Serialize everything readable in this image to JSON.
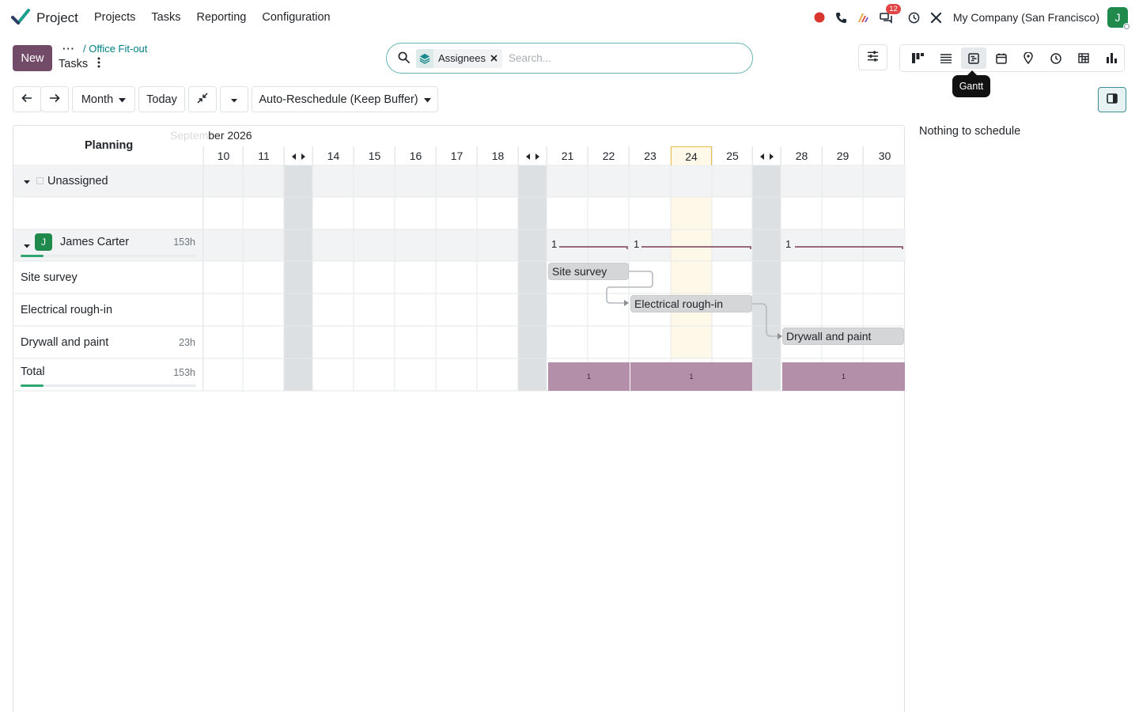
{
  "app": {
    "name": "Project"
  },
  "menu": [
    "Projects",
    "Tasks",
    "Reporting",
    "Configuration"
  ],
  "systray": {
    "messages_count": "12",
    "company": "My Company (San Francisco)",
    "avatar": "J"
  },
  "control": {
    "new_label": "New",
    "breadcrumb_parent": "/ Office Fit-out",
    "breadcrumb_current": "Tasks",
    "search": {
      "facet": "Assignees",
      "placeholder": "Search..."
    },
    "tooltip": "Gantt"
  },
  "toolbar": {
    "scale": "Month",
    "today": "Today",
    "reschedule": "Auto-Reschedule (Keep Buffer)"
  },
  "side_panel": {
    "text": "Nothing to schedule"
  },
  "gantt": {
    "title": "Planning",
    "month_visible": "ber 2026",
    "month_hidden": "Septem",
    "days": [
      "10",
      "11",
      "14",
      "15",
      "16",
      "17",
      "18",
      "21",
      "22",
      "23",
      "24",
      "25",
      "28",
      "29",
      "30"
    ],
    "today": "24",
    "rows": {
      "unassigned": "Unassigned",
      "assignee": {
        "name": "James Carter",
        "avatar": "J",
        "hours": "153h",
        "progress": 0.13
      },
      "tasks": [
        {
          "name": "Site survey",
          "hours": ""
        },
        {
          "name": "Electrical rough-in",
          "hours": ""
        },
        {
          "name": "Drywall and paint",
          "hours": "23h"
        }
      ],
      "total": {
        "label": "Total",
        "hours": "153h",
        "progress": 0.13
      }
    },
    "pills": [
      "Site survey",
      "Electrical rough-in",
      "Drywall and paint"
    ],
    "group_counts": [
      "1",
      "1",
      "1"
    ],
    "load_counts": [
      "1",
      "1",
      "1"
    ]
  },
  "colors": {
    "brand": "#714b67",
    "accent": "#017e84",
    "today": "#e8bf4c",
    "load": "#b38fa9",
    "weekend": "#dde0e3"
  }
}
